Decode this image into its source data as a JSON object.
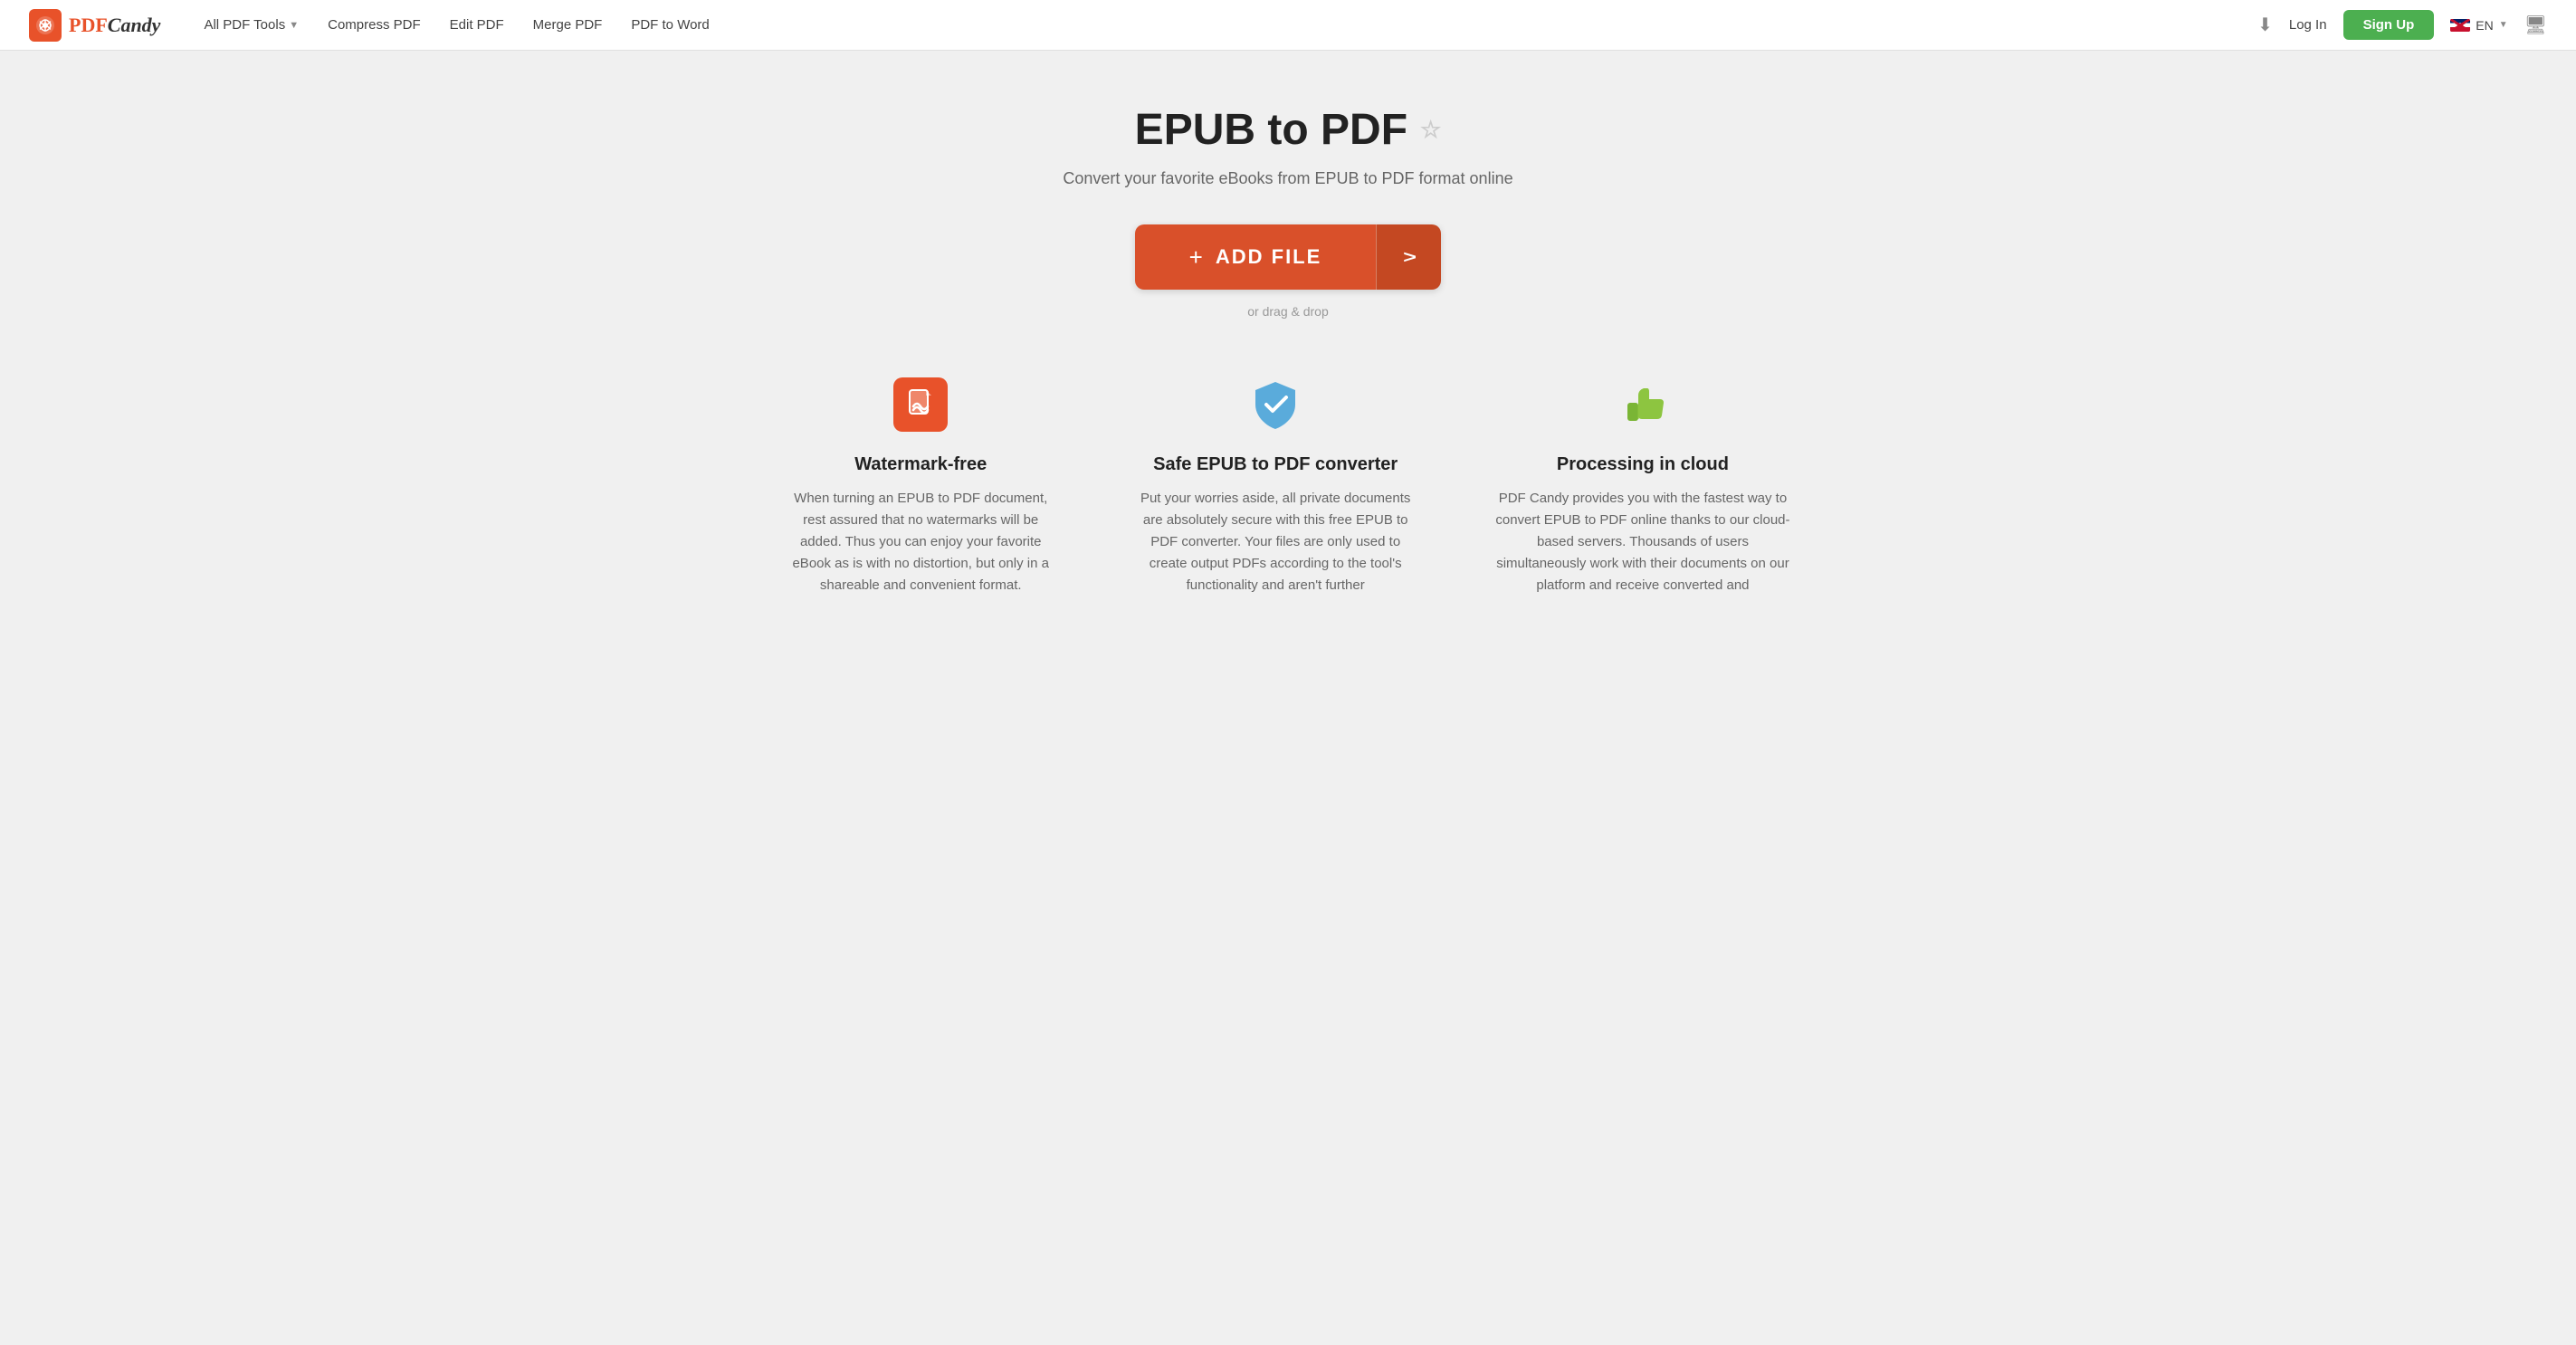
{
  "header": {
    "logo_text_pdf": "PDF",
    "logo_text_candy": "Candy",
    "nav": {
      "all_tools": "All PDF Tools",
      "compress": "Compress PDF",
      "edit": "Edit PDF",
      "merge": "Merge PDF",
      "pdf_to_word": "PDF to Word"
    },
    "login": "Log In",
    "signup": "Sign Up",
    "lang": "EN"
  },
  "main": {
    "title": "EPUB to PDF",
    "subtitle": "Convert your favorite eBooks from EPUB to PDF format online",
    "add_file_label": "ADD FILE",
    "drag_drop": "or drag & drop"
  },
  "features": [
    {
      "id": "watermark-free",
      "title": "Watermark-free",
      "desc": "When turning an EPUB to PDF document, rest assured that no watermarks will be added. Thus you can enjoy your favorite eBook as is with no distortion, but only in a shareable and convenient format."
    },
    {
      "id": "safe-converter",
      "title": "Safe EPUB to PDF converter",
      "desc": "Put your worries aside, all private documents are absolutely secure with this free EPUB to PDF converter. Your files are only used to create output PDFs according to the tool's functionality and aren't further"
    },
    {
      "id": "cloud-processing",
      "title": "Processing in cloud",
      "desc": "PDF Candy provides you with the fastest way to convert EPUB to PDF online thanks to our cloud-based servers. Thousands of users simultaneously work with their documents on our platform and receive converted and"
    }
  ]
}
